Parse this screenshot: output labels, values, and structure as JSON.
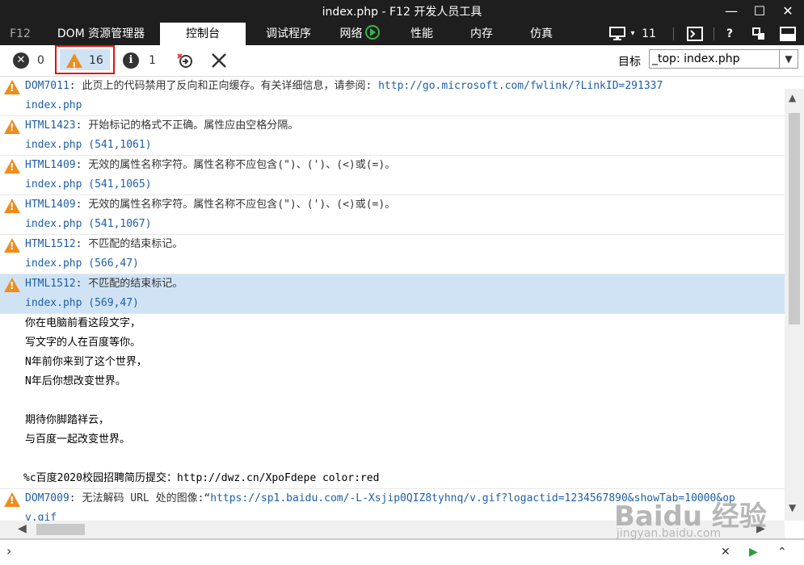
{
  "window": {
    "title": "index.php - F12 开发人员工具",
    "minimize": "—",
    "maximize": "☐",
    "close": "✕"
  },
  "tabs": [
    {
      "label": "F12"
    },
    {
      "label": "DOM 资源管理器"
    },
    {
      "label": "控制台"
    },
    {
      "label": "调试程序"
    },
    {
      "label": "网络"
    },
    {
      "label": "性能"
    },
    {
      "label": "内存"
    },
    {
      "label": "仿真"
    }
  ],
  "tabbar_right": {
    "screen_count": "11",
    "help": "?"
  },
  "toolbar": {
    "errors_count": "0",
    "warnings_count": "16",
    "info_count": "1",
    "target_label": "目标",
    "target_value": "_top: index.php"
  },
  "messages": [
    {
      "type": "warning",
      "code": "DOM7011",
      "text": ": 此页上的代码禁用了反向和正向缓存。有关详细信息，请参阅: ",
      "link": "http://go.microsoft.com/fwlink/?LinkID=291337",
      "loc": "index.php"
    },
    {
      "type": "warning",
      "code": "HTML1423",
      "text": ": 开始标记的格式不正确。属性应由空格分隔。",
      "loc": "index.php (541,1061)"
    },
    {
      "type": "warning",
      "code": "HTML1409",
      "text": ": 无效的属性名称字符。属性名称不应包含(\")、(')、(<)或(=)。",
      "loc": "index.php (541,1065)"
    },
    {
      "type": "warning",
      "code": "HTML1409",
      "text": ": 无效的属性名称字符。属性名称不应包含(\")、(')、(<)或(=)。",
      "loc": "index.php (541,1067)"
    },
    {
      "type": "warning",
      "code": "HTML1512",
      "text": ": 不匹配的结束标记。",
      "loc": "index.php (566,47)"
    },
    {
      "type": "warning",
      "code": "HTML1512",
      "text": ": 不匹配的结束标记。",
      "loc": "index.php (569,47)",
      "selected": true
    }
  ],
  "log_lines": [
    "你在电脑前看这段文字，",
    "写文字的人在百度等你。",
    "N年前你来到了这个世界，",
    "N年后你想改变世界。",
    "",
    "期待你脚踏祥云，",
    "与百度一起改变世界。",
    ""
  ],
  "log_tail": "%c百度2020校园招聘简历提交：http://dwz.cn/XpoFdepe color:red",
  "last_message": {
    "type": "warning",
    "code": "DOM7009",
    "text": ": 无法解码 URL 处的图像:“",
    "link": "https://sp1.baidu.com/-L-Xsjip0QIZ8tyhnq/v.gif?logactid=1234567890&showTab=10000&op",
    "link_cont": "v.gif"
  },
  "input": {
    "prompt": "›"
  },
  "watermark": {
    "logo": "Baidu 经验",
    "url": "jingyan.baidu.com"
  },
  "colors": {
    "titlebar": "#1e1e1e",
    "warning": "#f08c1a",
    "link": "#1f5fa6",
    "selected": "#cfe3f5",
    "highlight_border": "#e01010"
  }
}
